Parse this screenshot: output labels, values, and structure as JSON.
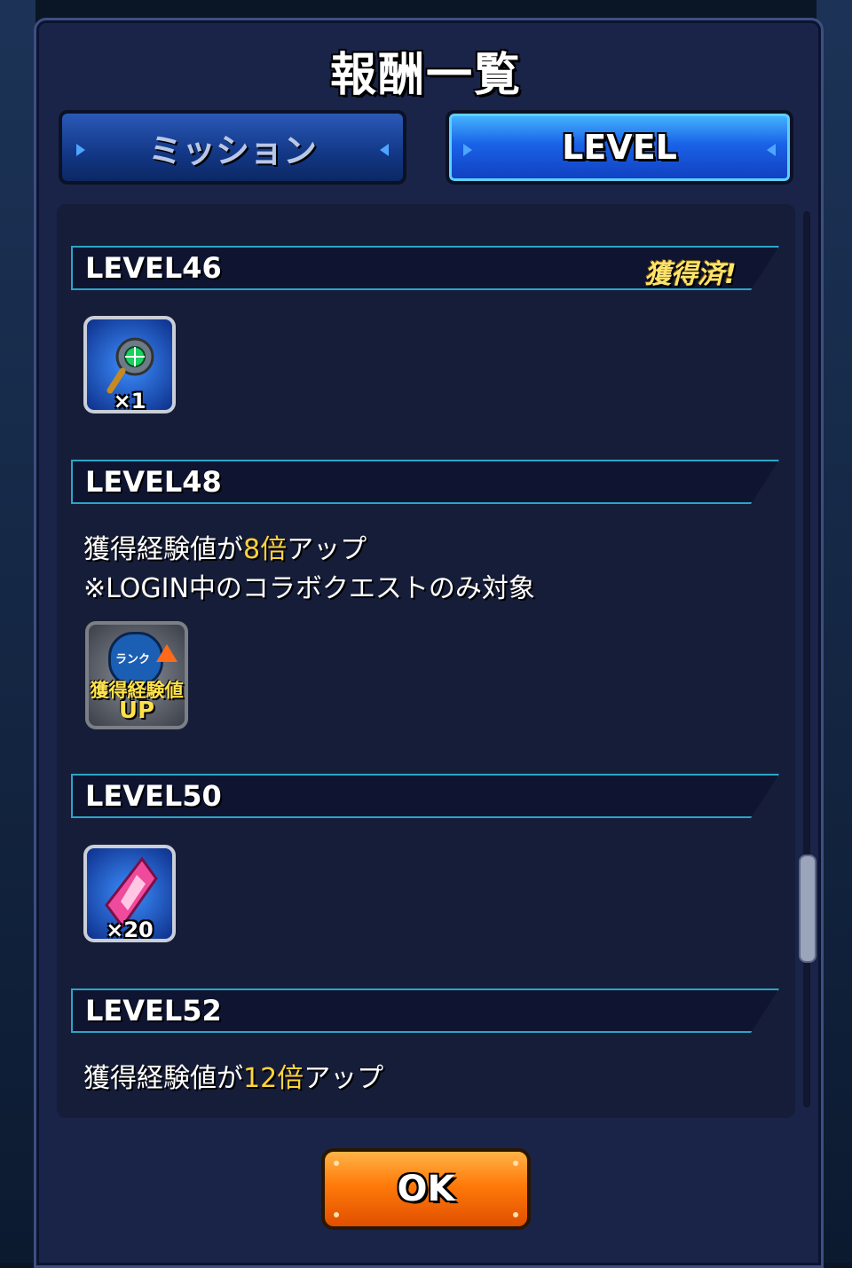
{
  "dialog": {
    "title": "報酬一覧"
  },
  "tabs": {
    "mission": "ミッション",
    "level": "LEVEL",
    "active": "level"
  },
  "rewards": [
    {
      "level": "LEVEL46",
      "obtained_badge": "獲得済!",
      "item_icon": "magnifier-item-icon",
      "quantity": "×1"
    },
    {
      "level": "LEVEL48",
      "description_prefix": "獲得経験値が",
      "description_highlight": "8倍",
      "description_suffix": "アップ",
      "note": "※LOGIN中のコラボクエストのみ対象",
      "item_icon": "exp-up-icon",
      "icon_text_rank": "ランク",
      "icon_text_main": "獲得経験値",
      "icon_text_up": "UP"
    },
    {
      "level": "LEVEL50",
      "item_icon": "pink-gem-icon",
      "quantity": "×20"
    },
    {
      "level": "LEVEL52",
      "description_prefix": "獲得経験値が",
      "description_highlight": "12倍",
      "description_suffix": "アップ"
    }
  ],
  "ok_button": "OK",
  "colors": {
    "dialog_bg": "#1a2448",
    "tab_active": "#1a62e8",
    "highlight": "#ffd33a",
    "ok_orange": "#ff7a0a"
  }
}
